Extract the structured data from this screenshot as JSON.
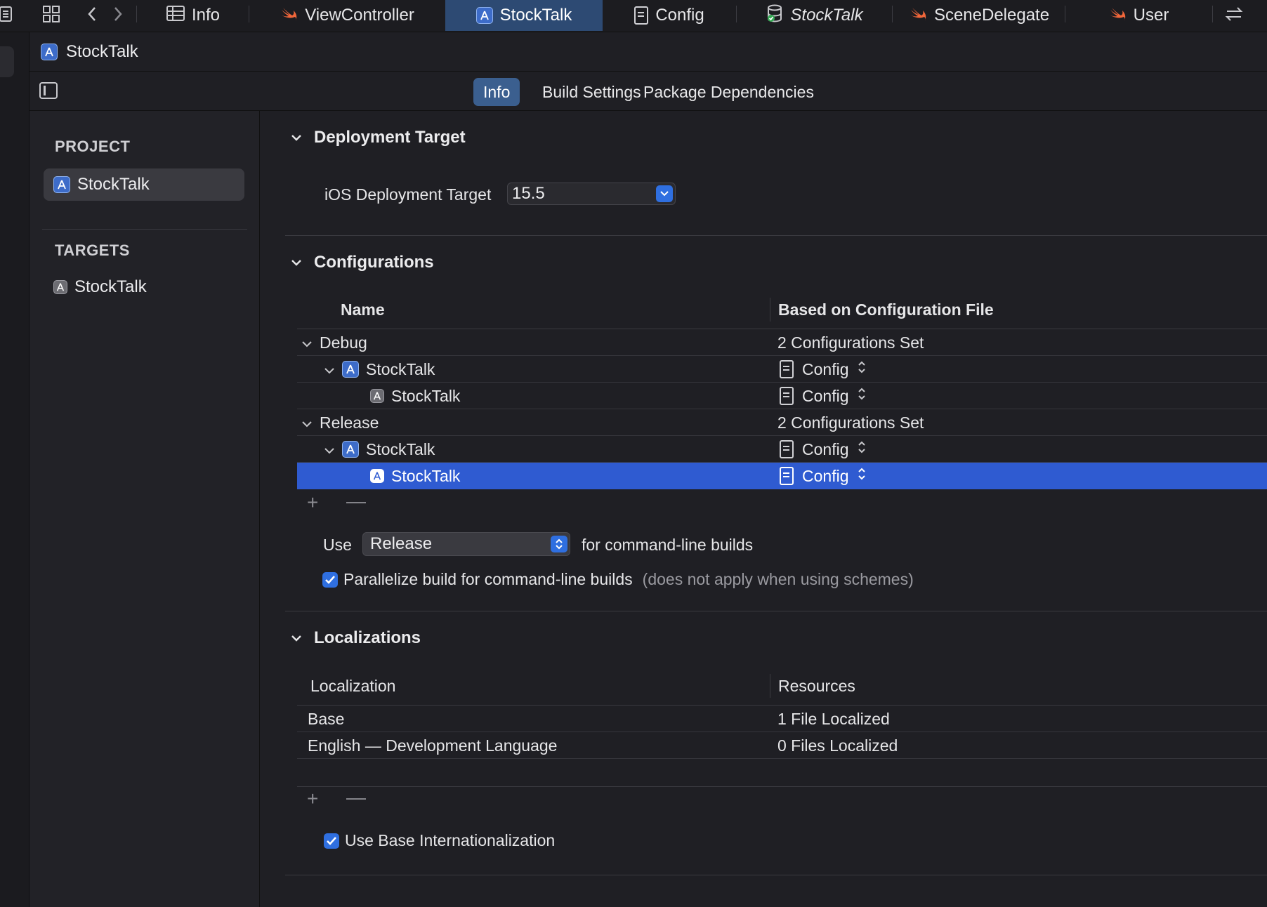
{
  "tabs": [
    {
      "label": "Info",
      "icon": "table-icon"
    },
    {
      "label": "ViewController",
      "icon": "swift-icon"
    },
    {
      "label": "StockTalk",
      "icon": "app-icon",
      "active": true
    },
    {
      "label": "Config",
      "icon": "document-icon"
    },
    {
      "label": "StockTalk",
      "icon": "database-icon",
      "italic": true
    },
    {
      "label": "SceneDelegate",
      "icon": "swift-icon"
    },
    {
      "label": "User",
      "icon": "swift-icon"
    }
  ],
  "jumpbar": {
    "label": "StockTalk"
  },
  "editor_tabs": [
    "Info",
    "Build Settings",
    "Package Dependencies"
  ],
  "sidebar": {
    "project_header": "PROJECT",
    "project_item": "StockTalk",
    "targets_header": "TARGETS",
    "target_item": "StockTalk"
  },
  "deployment": {
    "title": "Deployment Target",
    "label": "iOS Deployment Target",
    "value": "15.5"
  },
  "configurations": {
    "title": "Configurations",
    "col_name": "Name",
    "col_file": "Based on Configuration File",
    "rows": [
      {
        "name": "Debug",
        "file": "2 Configurations Set"
      },
      {
        "name": "StockTalk",
        "file": "Config"
      },
      {
        "name": "StockTalk",
        "file": "Config"
      },
      {
        "name": "Release",
        "file": "2 Configurations Set"
      },
      {
        "name": "StockTalk",
        "file": "Config"
      },
      {
        "name": "StockTalk",
        "file": "Config"
      }
    ],
    "use_label": "Use",
    "use_value": "Release",
    "use_suffix": "for command-line builds",
    "parallelize_label": "Parallelize build for command-line builds",
    "parallelize_note": "(does not apply when using schemes)",
    "parallelize_checked": true
  },
  "localizations": {
    "title": "Localizations",
    "col_loc": "Localization",
    "col_res": "Resources",
    "rows": [
      {
        "name": "Base",
        "resources": "1 File Localized"
      },
      {
        "name": "English — Development Language",
        "resources": "0 Files Localized"
      }
    ],
    "base_intl_label": "Use Base Internationalization",
    "base_intl_checked": true
  },
  "colors": {
    "accent": "#2f6fe0",
    "selection": "#2f5bd1",
    "swift": "#f0663a"
  }
}
